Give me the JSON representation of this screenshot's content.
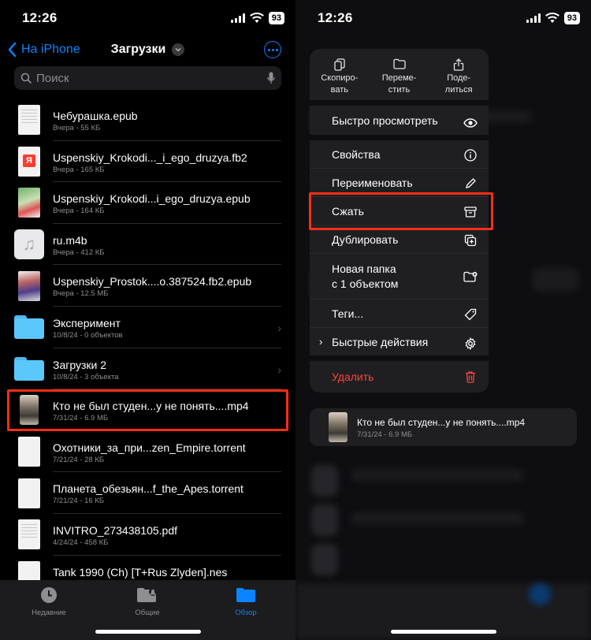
{
  "status": {
    "time": "12:26",
    "battery": "93"
  },
  "nav": {
    "back_label": "На iPhone",
    "title": "Загрузки"
  },
  "search": {
    "placeholder": "Поиск"
  },
  "files": [
    {
      "name": "Чебурашка.epub",
      "meta": "Вчера - 55 КБ",
      "icon": "document-icon"
    },
    {
      "name": "Uspenskiy_Krokodi..._i_ego_druzya.fb2",
      "meta": "Вчера - 165 КБ",
      "icon": "yandex-document-icon"
    },
    {
      "name": "Uspenskiy_Krokodi...i_ego_druzya.epub",
      "meta": "Вчера - 164 КБ",
      "icon": "book-cover-icon"
    },
    {
      "name": "ru.m4b",
      "meta": "Вчера - 412 КБ",
      "icon": "music-note-icon"
    },
    {
      "name": "Uspenskiy_Prostok....o.387524.fb2.epub",
      "meta": "Вчера - 12.5 МБ",
      "icon": "book-cover-icon"
    },
    {
      "name": "Эксперимент",
      "meta": "10/8/24 - 0 объектов",
      "icon": "folder-icon"
    },
    {
      "name": "Загрузки 2",
      "meta": "10/8/24 - 3 объекта",
      "icon": "folder-icon"
    },
    {
      "name": "Кто не был студен...у не понять....mp4",
      "meta": "7/31/24 - 6.9 МБ",
      "icon": "video-thumbnail-icon"
    },
    {
      "name": "Охотники_за_при...zen_Empire.torrent",
      "meta": "7/21/24 - 28 КБ",
      "icon": "document-icon"
    },
    {
      "name": "Планета_обезьян...f_the_Apes.torrent",
      "meta": "7/21/24 - 16 КБ",
      "icon": "document-icon"
    },
    {
      "name": "INVITRO_273438105.pdf",
      "meta": "4/24/24 - 458 КБ",
      "icon": "pdf-document-icon"
    },
    {
      "name": "Tank 1990 (Ch) [T+Rus Zlyden].nes",
      "meta": "",
      "icon": "document-icon"
    }
  ],
  "tabs": [
    {
      "label": "Недавние",
      "icon": "clock-icon"
    },
    {
      "label": "Общие",
      "icon": "shared-folder-icon"
    },
    {
      "label": "Обзор",
      "icon": "folder-icon"
    }
  ],
  "menu": {
    "top_actions": [
      {
        "line1": "Скопиро-",
        "line2": "вать",
        "icon": "copy-icon"
      },
      {
        "line1": "Переме-",
        "line2": "стить",
        "icon": "folder-icon"
      },
      {
        "line1": "Поде-",
        "line2": "литься",
        "icon": "share-icon"
      }
    ],
    "items": [
      {
        "label": "Быстро просмотреть",
        "icon": "eye-icon"
      },
      {
        "label": "Свойства",
        "icon": "info-icon"
      },
      {
        "label": "Переименовать",
        "icon": "pencil-icon"
      },
      {
        "label": "Сжать",
        "icon": "archive-box-icon"
      },
      {
        "label": "Дублировать",
        "icon": "duplicate-icon"
      },
      {
        "label_line1": "Новая папка",
        "label_line2": "с 1 объектом",
        "icon": "new-folder-icon"
      },
      {
        "label": "Теги...",
        "icon": "tag-icon"
      },
      {
        "label": "Быстрые действия",
        "icon": "gear-icon"
      },
      {
        "label": "Удалить",
        "icon": "trash-icon"
      }
    ]
  },
  "preview": {
    "name": "Кто не был студен...у не понять....mp4",
    "meta": "7/31/24 - 6.9 МБ"
  },
  "colors": {
    "accent": "#0a84ff",
    "highlight": "#ff2d16",
    "danger": "#ff453a"
  }
}
